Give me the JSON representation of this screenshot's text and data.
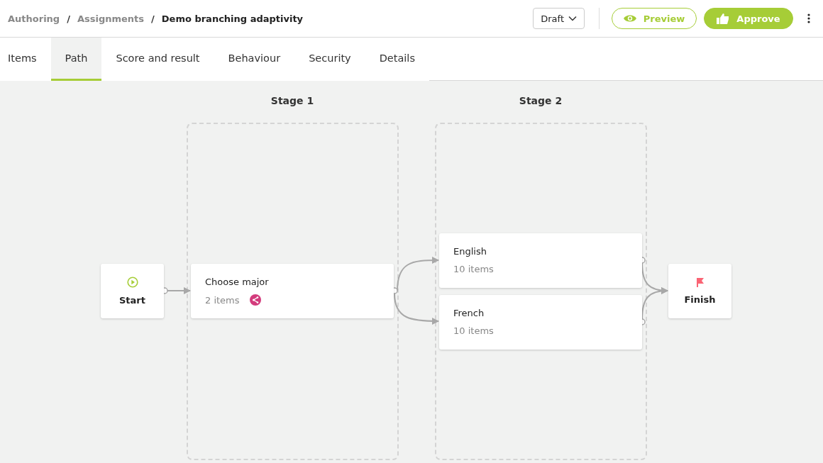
{
  "breadcrumbs": [
    {
      "label": "Authoring",
      "current": false
    },
    {
      "separator": "/",
      "label": "Assignments",
      "current": false
    },
    {
      "separator": "/",
      "label": "Demo branching adaptivity",
      "current": true
    }
  ],
  "status_dropdown": {
    "value": "Draft"
  },
  "buttons": [
    {
      "label": "Preview",
      "kind": "outline"
    },
    {
      "label": "Approve",
      "kind": "primary"
    }
  ],
  "tabs": [
    {
      "label": "Items",
      "selected": false
    },
    {
      "label": "Path",
      "selected": true
    },
    {
      "label": "Score and result",
      "selected": false
    },
    {
      "label": "Behaviour",
      "selected": false
    },
    {
      "label": "Security",
      "selected": false
    },
    {
      "label": "Details",
      "selected": false
    }
  ],
  "stages": [
    {
      "title": "Stage 1"
    },
    {
      "title": "Stage 2"
    }
  ],
  "nodes": [
    {
      "kind": "start",
      "label": "Start"
    },
    {
      "kind": "task",
      "title": "Choose major",
      "count": "2 items",
      "branching": true
    },
    {
      "kind": "task",
      "title": "English",
      "count": "10 items",
      "branching": false
    },
    {
      "kind": "task",
      "title": "French",
      "count": "10 items",
      "branching": false
    },
    {
      "kind": "finish",
      "label": "Finish"
    }
  ]
}
